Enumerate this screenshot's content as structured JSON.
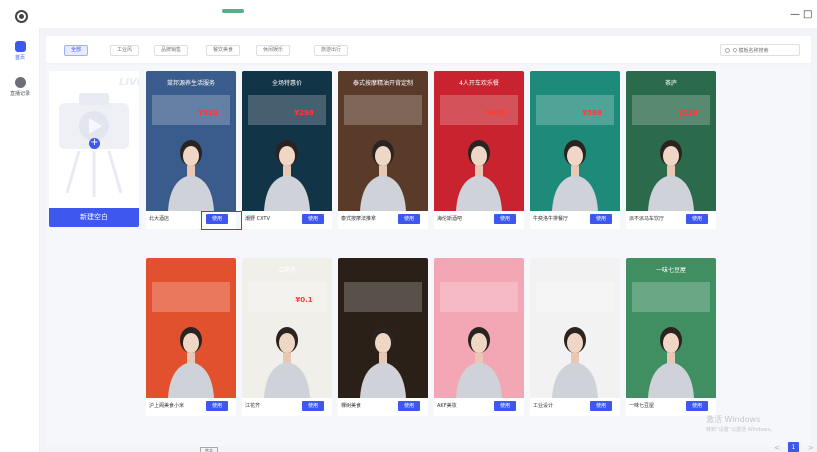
{
  "window": {
    "minimize": "—",
    "maximize": "□"
  },
  "sidebar": {
    "items": [
      {
        "label": "首页"
      },
      {
        "label": "直播记录"
      }
    ]
  },
  "filters": {
    "chips": [
      "全部",
      "工业风",
      "品牌销售",
      "餐饮美食",
      "休闲娱乐",
      "旅游出行"
    ],
    "active_index": 0
  },
  "search": {
    "placeholder": "Q 模板名称搜索"
  },
  "new_template": {
    "label": "新建空白",
    "bg_text": "LIVE"
  },
  "use_label": "使用",
  "templates": [
    {
      "name": "北大酒店",
      "poster": "棠邦源养生活服务",
      "price": "¥318",
      "bg": "#3a5c8c"
    },
    {
      "name": "潮野 CXTV",
      "poster": "全场特惠价",
      "price": "¥298",
      "bg": "#123447"
    },
    {
      "name": "泰式按摩法推拿",
      "poster": "泰式按摩精油开背定制",
      "price": "",
      "bg": "#5a3b2a"
    },
    {
      "name": "海伦斯酒吧",
      "poster": "4人开车欢乐餐",
      "price": "¥488",
      "bg": "#c8232e"
    },
    {
      "name": "牛奕洛牛排餐厅",
      "poster": "",
      "price": "¥398",
      "bg": "#1e8a7a"
    },
    {
      "name": "派不派马车饮厅",
      "poster": "茶庐",
      "price": "¥138",
      "bg": "#2b6a4a"
    },
    {
      "name": "沪上阁美食小米",
      "poster": "",
      "price": "",
      "bg": "#e2512d"
    },
    {
      "name": "江花齐",
      "poster": "江花齐",
      "price": "¥0.1",
      "bg": "#f1efe9"
    },
    {
      "name": "棵树美食",
      "poster": "",
      "price": "",
      "bg": "#2a2018"
    },
    {
      "name": "AKF美妆",
      "poster": "",
      "price": "",
      "bg": "#f3a7b4"
    },
    {
      "name": "工业设计",
      "poster": "",
      "price": "",
      "bg": "#f2f2f2"
    },
    {
      "name": "一味七豆屋",
      "poster": "一味七豆屋",
      "price": "",
      "bg": "#3f8f63"
    }
  ],
  "watermark": {
    "line1": "激活 Windows",
    "line2": "转到“设置”以激活 Windows。"
  },
  "pagination": {
    "prev": "<",
    "current": "1",
    "next": ">"
  },
  "bottom_tag": "售卖",
  "colors": {
    "accent": "#3d57ef",
    "highlight": "#e02020",
    "active_chip_bg": "#e6ebff"
  }
}
